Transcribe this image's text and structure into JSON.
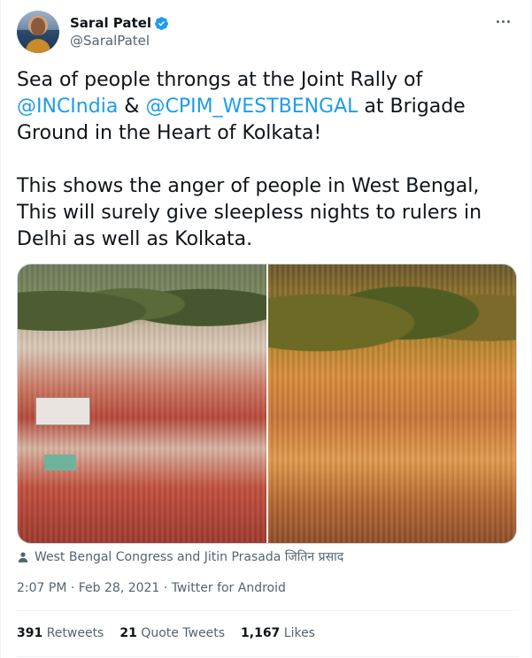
{
  "author": {
    "display_name": "Saral Patel",
    "handle": "@SaralPatel"
  },
  "tweet": {
    "line1_pre": "Sea of people throngs at the Joint Rally of ",
    "mention1": "@INCIndia",
    "line1_mid": " & ",
    "mention2": "@CPIM_WESTBENGAL",
    "line1_post": " at Brigade Ground in the Heart of Kolkata!",
    "paragraph2": "This shows the anger of people in West Bengal, This will surely give sleepless nights to rulers in Delhi as well as Kolkata."
  },
  "caption": "West Bengal Congress and Jitin Prasada जितिन प्रसाद",
  "meta": "2:07 PM · Feb 28, 2021 · Twitter for Android",
  "stats": {
    "retweets_count": "391",
    "retweets_label": "Retweets",
    "quotes_count": "21",
    "quotes_label": "Quote Tweets",
    "likes_count": "1,167",
    "likes_label": "Likes"
  },
  "colors": {
    "accent": "#1d9bf0",
    "muted": "#536471"
  }
}
